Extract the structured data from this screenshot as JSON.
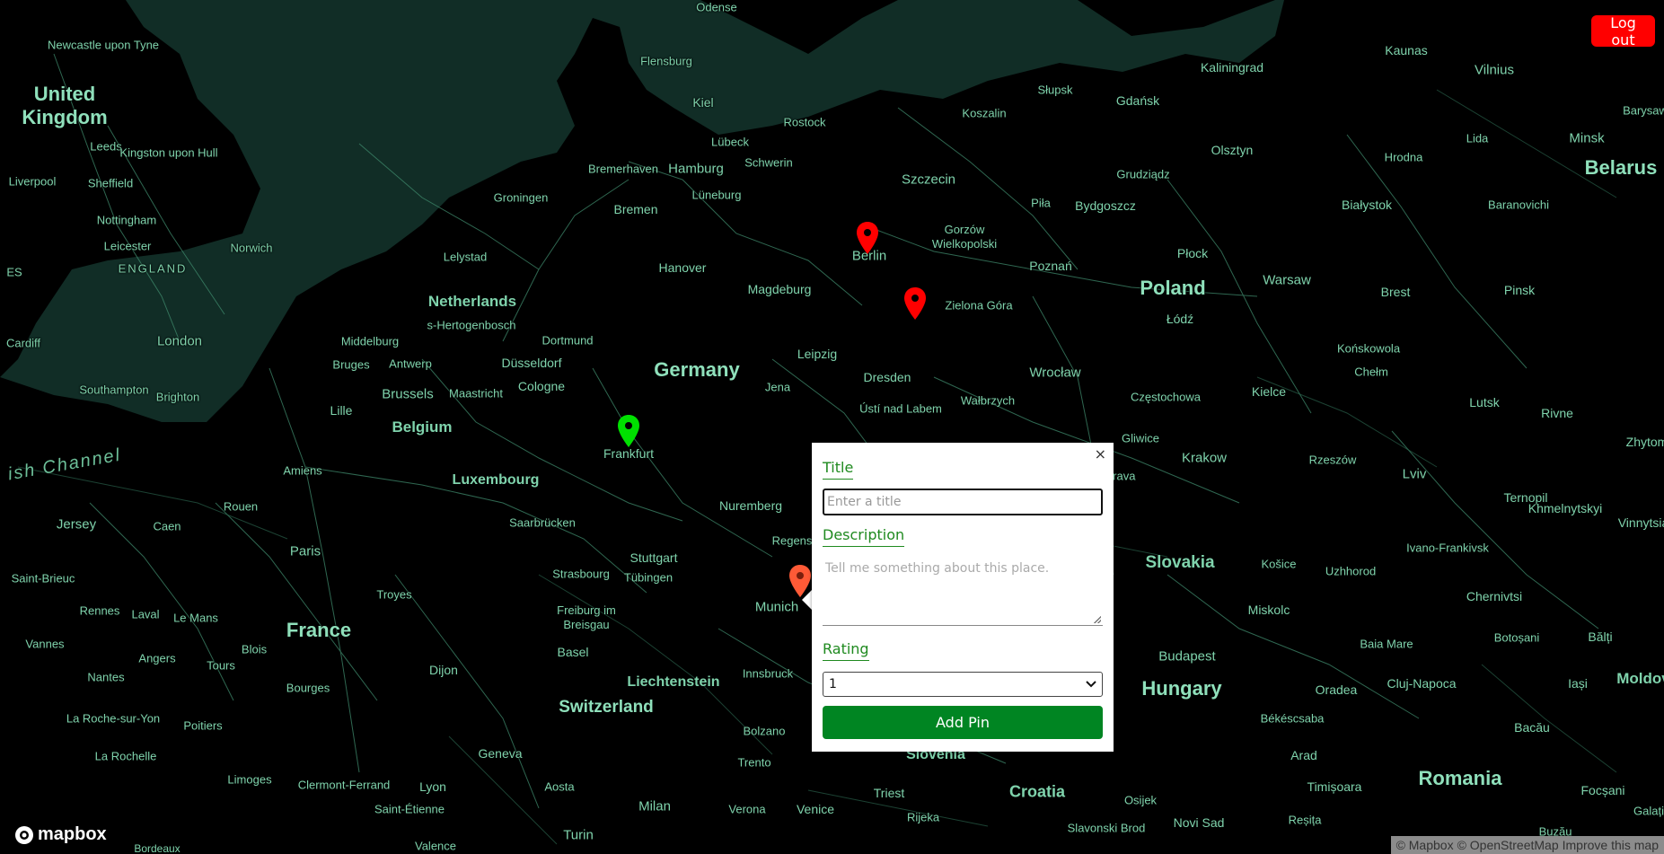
{
  "header": {
    "logout_label": "Log out"
  },
  "map": {
    "labels": {
      "united_kingdom": "United\nKingdom",
      "newcastle": "Newcastle upon Tyne",
      "leeds": "Leeds",
      "kingston": "Kingston upon Hull",
      "liverpool": "Liverpool",
      "sheffield": "Sheffield",
      "nottingham": "Nottingham",
      "leicester": "Leicester",
      "norwich": "Norwich",
      "england": "ENGLAND",
      "london": "London",
      "cardiff": "Cardiff",
      "southampton": "Southampton",
      "brighton": "Brighton",
      "es": "ES",
      "channel": "ish Channel",
      "jersey": "Jersey",
      "odense": "Odense",
      "flensburg": "Flensburg",
      "kiel": "Kiel",
      "rostock": "Rostock",
      "lubeck": "Lübeck",
      "hamburg": "Hamburg",
      "schwerin": "Schwerin",
      "bremerhaven": "Bremerhaven",
      "groningen": "Groningen",
      "bremen": "Bremen",
      "luneburg": "Lüneburg",
      "lelystad": "Lelystad",
      "hanover": "Hanover",
      "netherlands": "Netherlands",
      "hertogenbosch": "s-Hertogenbosch",
      "magdeburg": "Magdeburg",
      "dortmund": "Dortmund",
      "middelburg": "Middelburg",
      "bruges": "Bruges",
      "antwerp": "Antwerp",
      "dusseldorf": "Düsseldorf",
      "germany": "Germany",
      "leipzig": "Leipzig",
      "brussels": "Brussels",
      "maastricht": "Maastricht",
      "cologne": "Cologne",
      "dresden": "Dresden",
      "jena": "Jena",
      "lille": "Lille",
      "belgium": "Belgium",
      "usti": "Ústí nad Labem",
      "frankfurt": "Frankfurt",
      "amiens": "Amiens",
      "luxembourg": "Luxembourg",
      "nuremberg": "Nuremberg",
      "rouen": "Rouen",
      "caen": "Caen",
      "saarbrucken": "Saarbrücken",
      "paris": "Paris",
      "stuttgart": "Stuttgart",
      "tubingen": "Tübingen",
      "strasbourg": "Strasbourg",
      "regens": "Regens",
      "saint_brieuc": "Saint-Brieuc",
      "troyes": "Troyes",
      "munich": "Munich",
      "rennes": "Rennes",
      "laval": "Laval",
      "le_mans": "Le Mans",
      "freiburg": "Freiburg im Breisgau",
      "france": "France",
      "vannes": "Vannes",
      "blois": "Blois",
      "angers": "Angers",
      "tours": "Tours",
      "basel": "Basel",
      "dijon": "Dijon",
      "liechtenstein": "Liechtenstein",
      "innsbruck": "Innsbruck",
      "nantes": "Nantes",
      "bourges": "Bourges",
      "switzerland": "Switzerland",
      "la_roche": "La Roche-sur-Yon",
      "poitiers": "Poitiers",
      "bolzano": "Bolzano",
      "la_rochelle": "La Rochelle",
      "geneva": "Geneva",
      "trento": "Trento",
      "limoges": "Limoges",
      "clermont": "Clermont-Ferrand",
      "lyon": "Lyon",
      "aosta": "Aosta",
      "saint_etienne": "Saint-Étienne",
      "milan": "Milan",
      "verona": "Verona",
      "venice": "Venice",
      "turin": "Turin",
      "valence": "Valence",
      "bordeaux": "Bordeaux",
      "slupsk": "Słupsk",
      "gdansk": "Gdańsk",
      "koszalin": "Koszalin",
      "kaliningrad": "Kaliningrad",
      "kaunas": "Kaunas",
      "vilnius": "Vilnius",
      "szczecin": "Szczecin",
      "grudziadz": "Grudziądz",
      "olsztyn": "Olsztyn",
      "bydgoszcz": "Bydgoszcz",
      "pila": "Piła",
      "berlin": "Berlin",
      "gorzow": "Gorzów Wielkopolski",
      "poznan": "Poznań",
      "plock": "Płock",
      "zielona_gora": "Zielona Góra",
      "poland": "Poland",
      "warsaw": "Warsaw",
      "lodz": "Łódź",
      "wroclaw": "Wrocław",
      "walbrzych": "Wałbrzych",
      "czestochowa": "Częstochowa",
      "kielce": "Kielce",
      "konskowola": "Końskowola",
      "gliwice": "Gliwice",
      "krakow": "Krakow",
      "rzeszow": "Rzeszów",
      "strava": "trava",
      "lida": "Lida",
      "hrodna": "Hrodna",
      "bialystok": "Białystok",
      "baranovichi": "Baranovichi",
      "minsk": "Minsk",
      "belarus": "Belarus",
      "barysaw": "Barysaw",
      "brest": "Brest",
      "pinsk": "Pinsk",
      "chelm": "Chełm",
      "lutsk": "Lutsk",
      "rivne": "Rivne",
      "zhytom": "Zhytom",
      "lviv": "Lviv",
      "ternopil": "Ternopil",
      "khmelnytskyi": "Khmelnytskyi",
      "vinnytsia": "Vinnytsia",
      "ivano": "Ivano-Frankivsk",
      "kosice": "Košice",
      "uzhhorod": "Uzhhorod",
      "slovakia": "Slovakia",
      "miskolc": "Miskolc",
      "chernivtsi": "Chernivtsi",
      "budapest": "Budapest",
      "baia_mare": "Baia Mare",
      "botosani": "Botoșani",
      "balti": "Bălți",
      "hungary": "Hungary",
      "oradea": "Oradea",
      "cluj": "Cluj-Napoca",
      "iasi": "Iași",
      "moldova": "Moldov",
      "bekescsaba": "Békéscsaba",
      "bacau": "Bacău",
      "arad": "Arad",
      "slovenia": "Slovenia",
      "timisoara": "Timișoara",
      "romania": "Romania",
      "focsani": "Focșani",
      "croatia": "Croatia",
      "osijek": "Osijek",
      "trieste": "Triest",
      "rijeka": "Rijeka",
      "slavonski": "Slavonski Brod",
      "novi_sad": "Novi Sad",
      "resita": "Reșița",
      "buzau": "Buzău",
      "galati": "Galați",
      "ivano_top": "Ivano"
    }
  },
  "popup": {
    "close_label": "×",
    "title_label": "Title",
    "title_placeholder": "Enter a title",
    "description_label": "Description",
    "description_placeholder": "Tell me something about this place.",
    "rating_label": "Rating",
    "rating_value": "1",
    "submit_label": "Add Pin"
  },
  "markers": [
    {
      "name": "berlin-marker",
      "color": "#ff0000"
    },
    {
      "name": "zielona-gora-marker",
      "color": "#ff0000"
    },
    {
      "name": "frankfurt-marker",
      "color": "#00e000"
    },
    {
      "name": "munich-marker",
      "color": "#ff5a36"
    }
  ],
  "footer": {
    "mapbox_logo": "mapbox",
    "attribution_mapbox": "© Mapbox",
    "attribution_osm": "© OpenStreetMap",
    "attribution_improve": "Improve this map"
  },
  "colors": {
    "land": "#000000",
    "water": "#112d26",
    "roads": "#4f9c7c",
    "labels": "#7fd3ac",
    "logout": "#ff0000",
    "accent_green": "#1f8a1f",
    "button_green": "#008522"
  }
}
